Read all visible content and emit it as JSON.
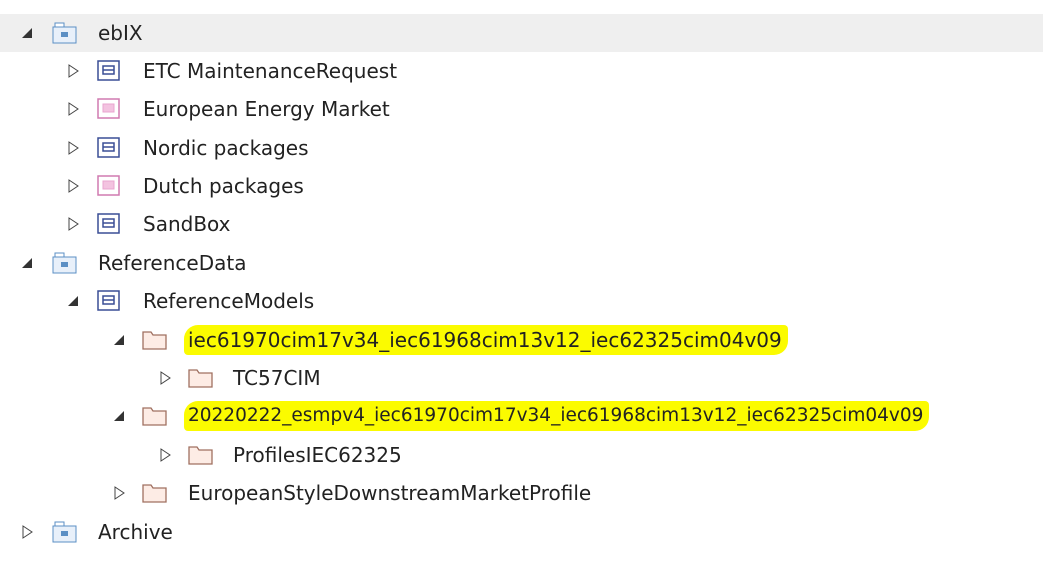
{
  "tree": {
    "items": [
      {
        "label": "ebIX",
        "state": "expanded",
        "icon": "model-root-icon",
        "level": 0,
        "highlighted": false
      },
      {
        "label": "ETC MaintenanceRequest",
        "state": "collapsed",
        "icon": "package-blue-icon",
        "level": 1,
        "highlighted": false
      },
      {
        "label": "European Energy Market",
        "state": "collapsed",
        "icon": "package-pink-icon",
        "level": 1,
        "highlighted": false
      },
      {
        "label": "Nordic packages",
        "state": "collapsed",
        "icon": "package-blue-icon",
        "level": 1,
        "highlighted": false
      },
      {
        "label": "Dutch packages",
        "state": "collapsed",
        "icon": "package-pink-icon",
        "level": 1,
        "highlighted": false
      },
      {
        "label": "SandBox",
        "state": "collapsed",
        "icon": "package-blue-icon",
        "level": 1,
        "highlighted": false
      },
      {
        "label": "ReferenceData",
        "state": "expanded",
        "icon": "model-root-icon",
        "level": 0,
        "highlighted": false
      },
      {
        "label": "ReferenceModels",
        "state": "expanded",
        "icon": "package-blue-icon",
        "level": 1,
        "highlighted": false
      },
      {
        "label": "iec61970cim17v34_iec61968cim13v12_iec62325cim04v09",
        "state": "expanded",
        "icon": "folder-icon",
        "level": 2,
        "highlighted": true
      },
      {
        "label": "TC57CIM",
        "state": "collapsed",
        "icon": "folder-icon",
        "level": 3,
        "highlighted": false
      },
      {
        "label": "20220222_esmpv4_iec61970cim17v34_iec61968cim13v12_iec62325cim04v09",
        "state": "expanded",
        "icon": "folder-icon",
        "level": 2,
        "highlighted": true
      },
      {
        "label": "ProfilesIEC62325",
        "state": "collapsed",
        "icon": "folder-icon",
        "level": 3,
        "highlighted": false
      },
      {
        "label": "EuropeanStyleDownstreamMarketProfile",
        "state": "collapsed",
        "icon": "folder-icon",
        "level": 2,
        "highlighted": false
      },
      {
        "label": "Archive",
        "state": "collapsed",
        "icon": "model-root-icon",
        "level": 0,
        "highlighted": false
      }
    ]
  },
  "colors": {
    "highlight": "#fbfb00",
    "selected_row": "#efefef",
    "folder_fill": "#fdece5",
    "folder_stroke": "#a07060",
    "package_blue": "#3a4e96",
    "package_pink": "#e8a6cf",
    "model_root": "#5b8fc4"
  }
}
